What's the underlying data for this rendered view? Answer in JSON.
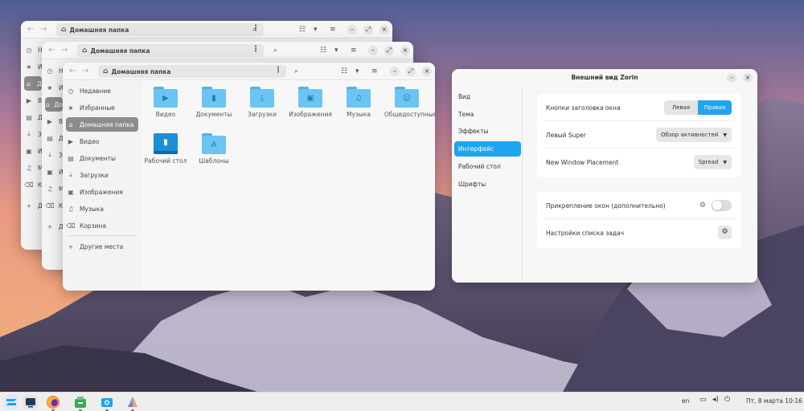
{
  "file_manager": {
    "path_label": "Домашняя папка",
    "sidebar": [
      {
        "label": "Недавние",
        "icon": "clock-icon"
      },
      {
        "label": "Избранные",
        "icon": "star-icon"
      },
      {
        "label": "Домашняя папка",
        "icon": "home-icon",
        "active": true
      },
      {
        "label": "Видео",
        "icon": "video-icon"
      },
      {
        "label": "Документы",
        "icon": "document-icon"
      },
      {
        "label": "Загрузки",
        "icon": "download-icon"
      },
      {
        "label": "Изображения",
        "icon": "image-icon"
      },
      {
        "label": "Музыка",
        "icon": "music-icon"
      },
      {
        "label": "Корзина",
        "icon": "trash-icon"
      },
      {
        "label": "Другие места",
        "icon": "plus-icon"
      }
    ],
    "back_sidebar": {
      "win1": [
        "Н",
        "И",
        "Д",
        "Ви",
        "Д",
        "З",
        "И",
        "М",
        "Ко",
        "Д"
      ],
      "win2": [
        "Не",
        "Из",
        "До",
        "Ви",
        "До",
        "За",
        "Из",
        "Му",
        "Ко",
        "Др"
      ]
    },
    "items": [
      {
        "label": "Видео",
        "icon": "video-folder-icon"
      },
      {
        "label": "Документы",
        "icon": "documents-folder-icon"
      },
      {
        "label": "Загрузки",
        "icon": "downloads-folder-icon"
      },
      {
        "label": "Изображения",
        "icon": "pictures-folder-icon"
      },
      {
        "label": "Музыка",
        "icon": "music-folder-icon"
      },
      {
        "label": "Общедоступные",
        "icon": "public-folder-icon"
      },
      {
        "label": "Рабочий стол",
        "icon": "desktop-folder-icon"
      },
      {
        "label": "Шаблоны",
        "icon": "templates-folder-icon"
      }
    ]
  },
  "appearance": {
    "title": "Внешний вид Zorin",
    "sidebar": [
      "Вид",
      "Тема",
      "Эффекты",
      "Интерфейс",
      "Рабочий стол",
      "Шрифты"
    ],
    "active_index": 3,
    "rows": {
      "titlebar_buttons": {
        "label": "Кнопки заголовка окна",
        "left": "Левая",
        "right": "Правая",
        "selected": "right"
      },
      "left_super": {
        "label": "Левый Super",
        "value": "Обзор активностей"
      },
      "window_placement": {
        "label": "New Window Placement",
        "value": "Spread"
      },
      "tiling": {
        "label": "Прикрепление окон (дополнительно)",
        "enabled": false
      },
      "tasklist": {
        "label": "Настройки списка задач"
      }
    },
    "accent_color": "#1fa4ef"
  },
  "taskbar": {
    "language": "en",
    "datetime": "Пт, 8 марта  10:16",
    "apps": [
      "zorin-menu-icon",
      "workspaces-icon",
      "firefox-icon",
      "software-store-icon",
      "files-icon",
      "appearance-icon"
    ]
  }
}
